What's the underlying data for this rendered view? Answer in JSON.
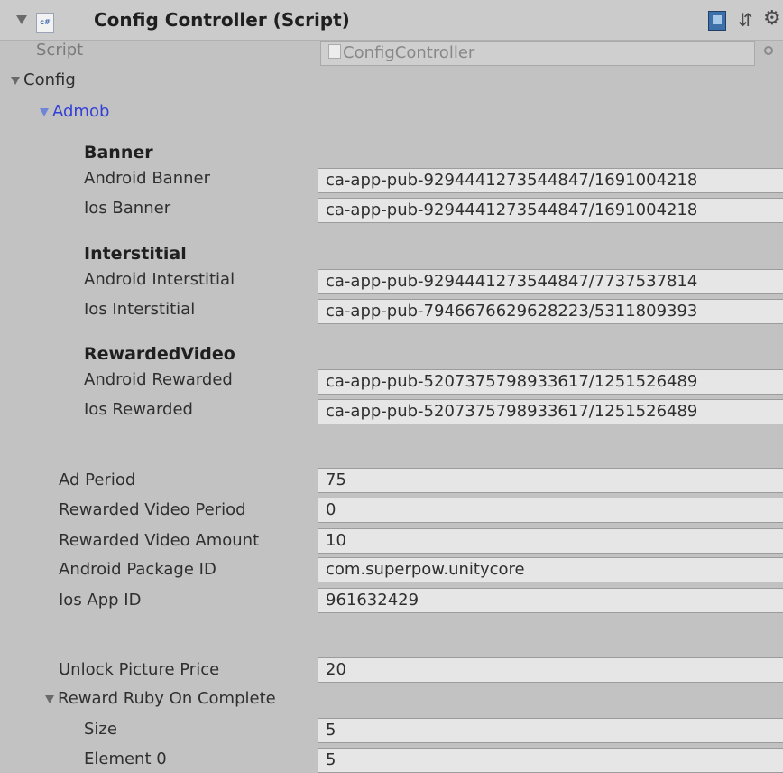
{
  "component": {
    "title": "Config Controller (Script)",
    "script_label": "Script",
    "script_value": "ConfigController",
    "cs_icon_text": "c#",
    "icons": [
      "cs-script-icon",
      "book-icon",
      "sliders-icon",
      "gear-icon",
      "target-icon"
    ]
  },
  "config": {
    "label": "Config",
    "admob": {
      "label": "Admob",
      "banner": {
        "header": "Banner",
        "android_label": "Android Banner",
        "android_value": "ca-app-pub-9294441273544847/1691004218",
        "ios_label": "Ios Banner",
        "ios_value": "ca-app-pub-9294441273544847/1691004218"
      },
      "interstitial": {
        "header": "Interstitial",
        "android_label": "Android Interstitial",
        "android_value": "ca-app-pub-9294441273544847/7737537814",
        "ios_label": "Ios Interstitial",
        "ios_value": "ca-app-pub-7946676629628223/5311809393"
      },
      "rewarded": {
        "header": "RewardedVideo",
        "android_label": "Android Rewarded",
        "android_value": "ca-app-pub-5207375798933617/1251526489",
        "ios_label": "Ios Rewarded",
        "ios_value": "ca-app-pub-5207375798933617/1251526489"
      }
    },
    "fields": {
      "ad_period_label": "Ad Period",
      "ad_period_value": "75",
      "rv_period_label": "Rewarded Video Period",
      "rv_period_value": "0",
      "rv_amount_label": "Rewarded Video Amount",
      "rv_amount_value": "10",
      "android_pkg_label": "Android Package ID",
      "android_pkg_value": "com.superpow.unitycore",
      "ios_app_label": "Ios App ID",
      "ios_app_value": "961632429",
      "unlock_price_label": "Unlock Picture Price",
      "unlock_price_value": "20"
    },
    "reward_ruby": {
      "label": "Reward Ruby On Complete",
      "size_label": "Size",
      "size_value": "5",
      "element0_label": "Element 0",
      "element0_value": "5"
    }
  }
}
